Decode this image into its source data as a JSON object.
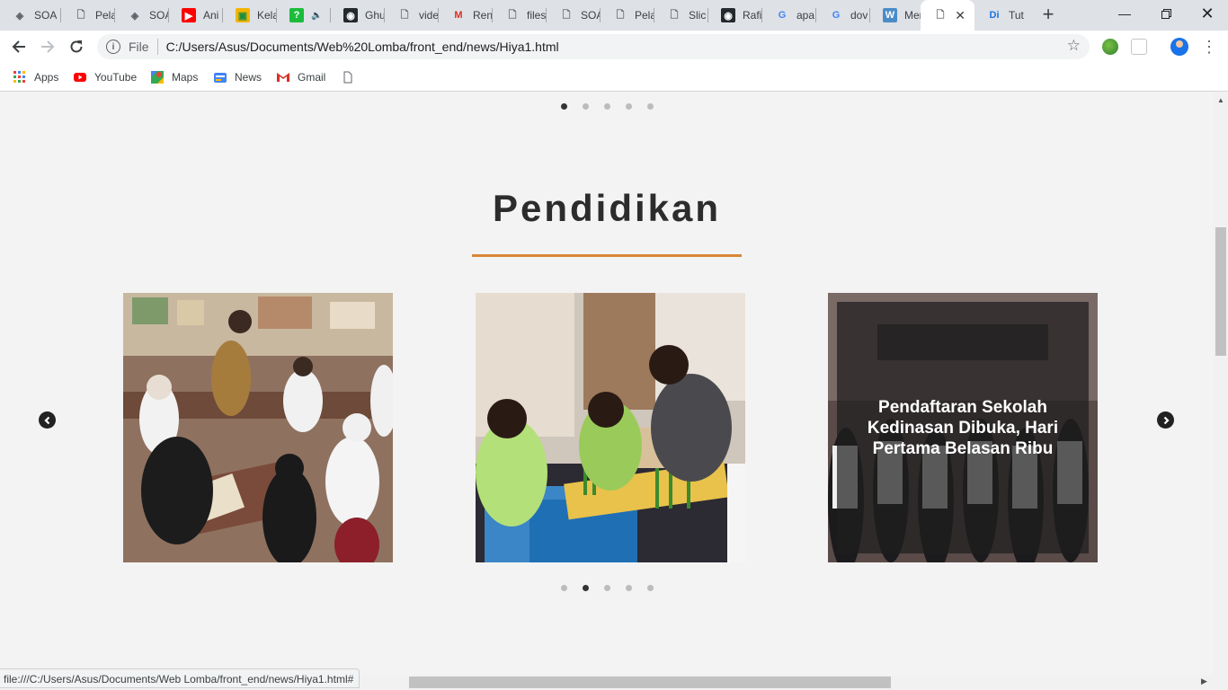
{
  "browser": {
    "tabs": [
      {
        "label": "SOA",
        "icon": "soa-icon"
      },
      {
        "label": "Pela",
        "icon": "page-icon"
      },
      {
        "label": "SOA",
        "icon": "soa-icon"
      },
      {
        "label": "Ani",
        "icon": "youtube-icon"
      },
      {
        "label": "Kela",
        "icon": "classroom-icon"
      },
      {
        "label": "",
        "icon": "quiz-icon"
      },
      {
        "label": "Ghu",
        "icon": "github-icon"
      },
      {
        "label": "vide",
        "icon": "page-icon"
      },
      {
        "label": "Ren",
        "icon": "gmail-icon"
      },
      {
        "label": "files",
        "icon": "page-icon"
      },
      {
        "label": "SOA",
        "icon": "page-icon"
      },
      {
        "label": "Pela",
        "icon": "page-icon"
      },
      {
        "label": "Slic",
        "icon": "page-icon"
      },
      {
        "label": "Rafi",
        "icon": "github-icon"
      },
      {
        "label": "apa",
        "icon": "google-icon"
      },
      {
        "label": "dov",
        "icon": "google-icon"
      },
      {
        "label": "Mer",
        "icon": "wordpress-icon"
      },
      {
        "label": "",
        "icon": "page-icon",
        "active": true
      },
      {
        "label": "Tut",
        "icon": "di-icon"
      }
    ],
    "url_scheme": "File",
    "url": "C:/Users/Asus/Documents/Web%20Lomba/front_end/news/Hiya1.html",
    "bookmarks": [
      "Apps",
      "YouTube",
      "Maps",
      "News",
      "Gmail"
    ],
    "status_url": "file:///C:/Users/Asus/Documents/Web Lomba/front_end/news/Hiya1.html#"
  },
  "page": {
    "top_carousel_dots": 5,
    "top_active_dot": 0,
    "section_title": "Pendidikan",
    "cards": [
      {
        "name": "classroom-photo",
        "caption": ""
      },
      {
        "name": "students-model-photo",
        "caption": ""
      },
      {
        "name": "stan-photo",
        "caption": "Pendaftaran Sekolah Kedinasan Dibuka, Hari Pertama Belasan Ribu"
      }
    ],
    "bottom_carousel_dots": 5,
    "bottom_active_dot": 1,
    "accent_color": "#d98738"
  }
}
